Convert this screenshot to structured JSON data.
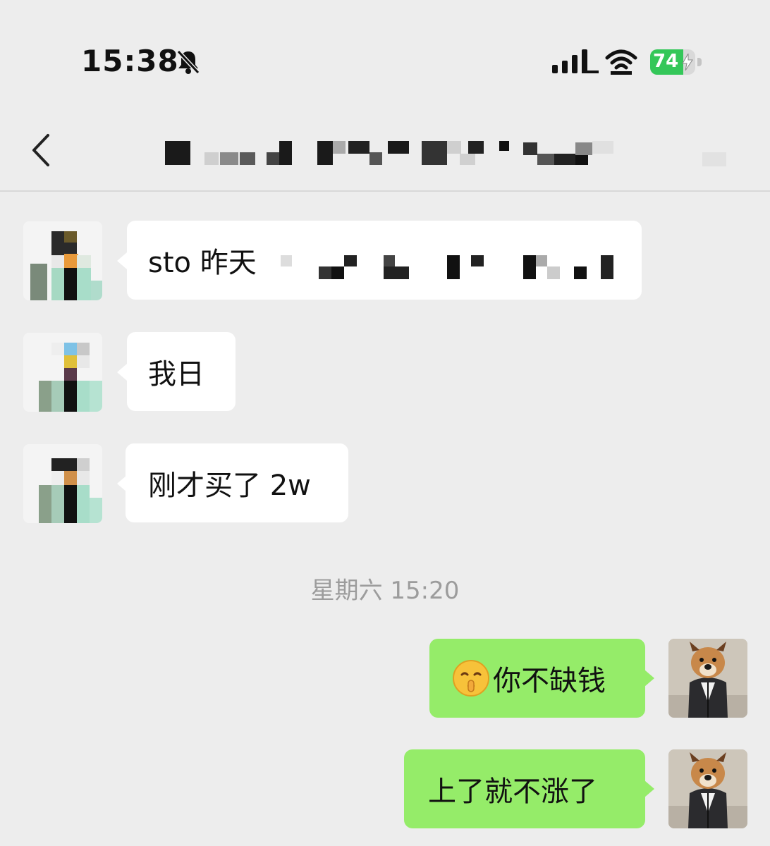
{
  "status_bar": {
    "time": "15:38",
    "battery": "74",
    "battery_level": 0.74,
    "icons": [
      "bell-slash-icon",
      "cellular-signal-icon",
      "wifi-icon",
      "battery-charging-icon"
    ]
  },
  "nav": {
    "back_icon": "chevron-left-icon",
    "title": ""
  },
  "messages": [
    {
      "side": "left",
      "text": "sto 昨天"
    },
    {
      "side": "left",
      "text": "我日"
    },
    {
      "side": "left",
      "text": "刚才买了 2w"
    },
    {
      "side": "right",
      "emoji": "shushing-face-icon",
      "text": "你不缺钱"
    },
    {
      "side": "right",
      "text": "上了就不涨了"
    }
  ],
  "timestamp": "星期六 15:20",
  "colors": {
    "background": "#ededed",
    "incoming_bubble": "#ffffff",
    "outgoing_bubble": "#95ec69",
    "battery_green": "#34c759",
    "timestamp_text": "#9c9c9c"
  }
}
